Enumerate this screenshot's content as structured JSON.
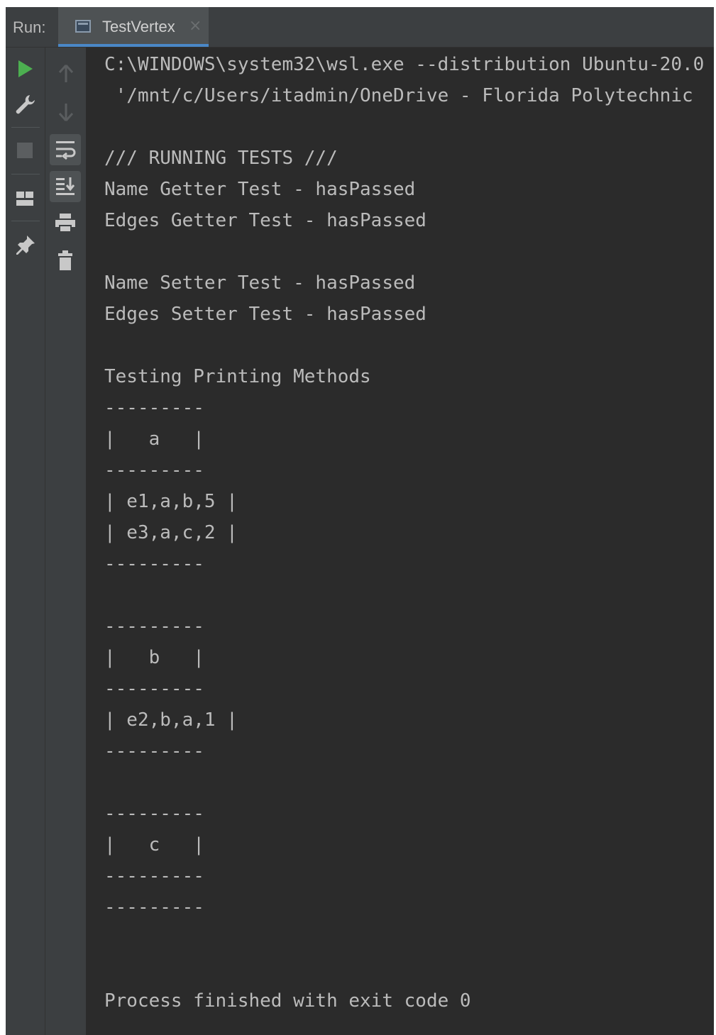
{
  "run_panel": {
    "label": "Run:",
    "tab": {
      "title": "TestVertex",
      "close_glyph": "×"
    }
  },
  "toolbar_icons": {
    "left": [
      "play-icon",
      "wrench-icon",
      "stop-icon",
      "layout-icon",
      "pin-icon"
    ],
    "right": [
      "arrow-up-icon",
      "arrow-down-icon",
      "soft-wrap-icon",
      "scroll-to-end-icon",
      "print-icon",
      "trash-icon"
    ]
  },
  "colors": {
    "background": "#2b2b2b",
    "toolbar": "#3c3f41",
    "text": "#bbbbbb",
    "run_green": "#4caf50",
    "tab_accent": "#4a88c7"
  },
  "console": {
    "lines": [
      "C:\\WINDOWS\\system32\\wsl.exe --distribution Ubuntu-20.0",
      " '/mnt/c/Users/itadmin/OneDrive - Florida Polytechnic",
      "",
      "/// RUNNING TESTS ///",
      "Name Getter Test - hasPassed",
      "Edges Getter Test - hasPassed",
      "",
      "Name Setter Test - hasPassed",
      "Edges Setter Test - hasPassed",
      "",
      "Testing Printing Methods",
      "---------",
      "|   a   |",
      "---------",
      "| e1,a,b,5 |",
      "| e3,a,c,2 |",
      "---------",
      "",
      "---------",
      "|   b   |",
      "---------",
      "| e2,b,a,1 |",
      "---------",
      "",
      "---------",
      "|   c   |",
      "---------",
      "---------",
      "",
      "",
      "Process finished with exit code 0"
    ]
  }
}
